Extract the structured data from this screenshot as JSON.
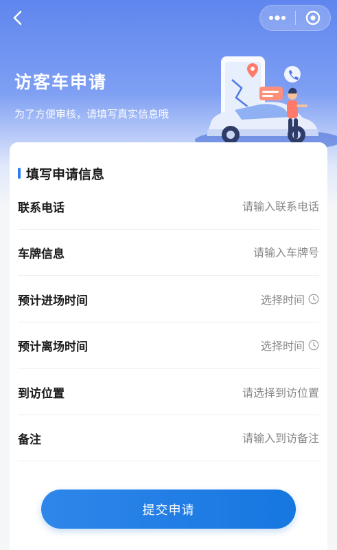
{
  "nav": {
    "back_icon": "chevron-left-icon",
    "more_icon": "more-dots-icon",
    "close_icon": "target-circle-icon"
  },
  "hero": {
    "title": "访客车申请",
    "subtitle": "为了方便审核，请填写真实信息哦"
  },
  "form": {
    "section_title": "填写申请信息",
    "phone": {
      "label": "联系电话",
      "placeholder": "请输入联系电话"
    },
    "plate": {
      "label": "车牌信息",
      "placeholder": "请输入车牌号"
    },
    "enter_time": {
      "label": "预计进场时间",
      "value": "选择时间",
      "icon": "clock-icon"
    },
    "leave_time": {
      "label": "预计离场时间",
      "value": "选择时间",
      "icon": "clock-icon"
    },
    "location": {
      "label": "到访位置",
      "value": "请选择到访位置"
    },
    "remark": {
      "label": "备注",
      "placeholder": "请输入到访备注"
    }
  },
  "submit": {
    "label": "提交申请"
  },
  "colors": {
    "primary": "#1677e0",
    "hero_gradient_top": "#5f86ee",
    "accent_bar": "#2a7df0"
  }
}
